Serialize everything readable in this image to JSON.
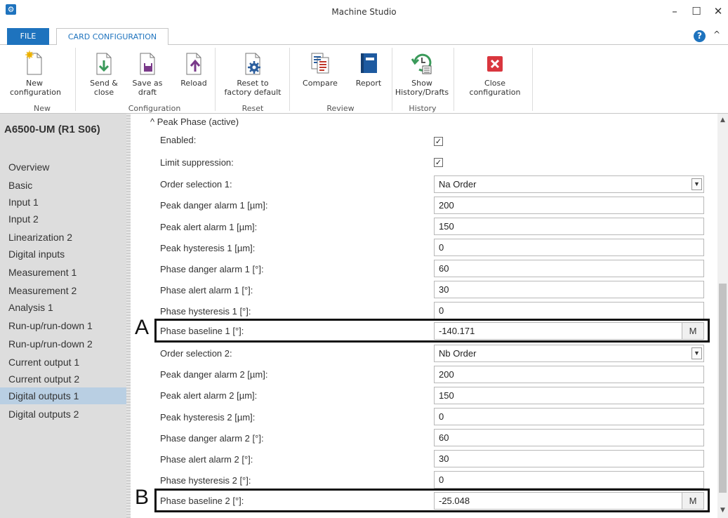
{
  "window": {
    "title": "Machine Studio",
    "minimize": "–",
    "maximize": "☐",
    "close": "✕"
  },
  "tabs": {
    "file": "FILE",
    "card_configuration": "CARD CONFIGURATION",
    "collapse": "^"
  },
  "ribbon": {
    "buttons": [
      {
        "label": "New\nconfiguration",
        "icon": "new-document-icon"
      },
      {
        "label": "Send &\nclose",
        "icon": "send-close-icon"
      },
      {
        "label": "Save as\ndraft",
        "icon": "save-draft-icon"
      },
      {
        "label": "Reload",
        "icon": "reload-icon"
      },
      {
        "label": "Reset to\nfactory default",
        "icon": "reset-gear-icon"
      },
      {
        "label": "Compare",
        "icon": "compare-icon"
      },
      {
        "label": "Report",
        "icon": "report-icon"
      },
      {
        "label": "Show\nHistory/Drafts",
        "icon": "history-icon"
      },
      {
        "label": "Close\nconfiguration",
        "icon": "close-config-icon"
      }
    ],
    "groups": [
      "New",
      "Configuration",
      "Reset",
      "Review",
      "History"
    ]
  },
  "sidebar": {
    "title": "A6500-UM (R1 S06)",
    "items": [
      "Overview",
      "Basic",
      "Input 1",
      "Input 2",
      "Linearization 2",
      "Digital inputs",
      "Measurement 1",
      "Measurement 2",
      "Analysis 1",
      "Run-up/run-down 1",
      "Run-up/run-down 2",
      "Current output 1",
      "Current output 2",
      "Digital outputs 1",
      "Digital outputs 2"
    ],
    "selected_index": 13
  },
  "content": {
    "section_header": "^ Peak Phase (active)",
    "rows": [
      {
        "label": "Enabled:",
        "type": "checkbox",
        "checked": true
      },
      {
        "label": "Limit suppression:",
        "type": "checkbox",
        "checked": true
      },
      {
        "label": "Order selection 1:",
        "type": "select",
        "value": "Na Order"
      },
      {
        "label": "Peak danger alarm 1 [µm]:",
        "type": "text",
        "value": "200"
      },
      {
        "label": "Peak alert alarm 1 [µm]:",
        "type": "text",
        "value": "150"
      },
      {
        "label": "Peak hysteresis 1 [µm]:",
        "type": "text",
        "value": "0"
      },
      {
        "label": "Phase danger alarm 1 [°]:",
        "type": "text",
        "value": "60"
      },
      {
        "label": "Phase alert alarm 1 [°]:",
        "type": "text",
        "value": "30"
      },
      {
        "label": "Phase hysteresis 1 [°]:",
        "type": "text",
        "value": "0"
      },
      {
        "label": "Phase baseline 1 [°]:",
        "type": "measure",
        "value": "-140.171",
        "button": "M"
      },
      {
        "label": "Order selection 2:",
        "type": "select",
        "value": "Nb Order"
      },
      {
        "label": "Peak danger alarm 2 [µm]:",
        "type": "text",
        "value": "200"
      },
      {
        "label": "Peak alert alarm 2 [µm]:",
        "type": "text",
        "value": "150"
      },
      {
        "label": "Peak hysteresis 2 [µm]:",
        "type": "text",
        "value": "0"
      },
      {
        "label": "Phase danger alarm 2 [°]:",
        "type": "text",
        "value": "60"
      },
      {
        "label": "Phase alert alarm 2 [°]:",
        "type": "text",
        "value": "30"
      },
      {
        "label": "Phase hysteresis 2 [°]:",
        "type": "text",
        "value": "0"
      },
      {
        "label": "Phase baseline 2 [°]:",
        "type": "measure",
        "value": "-25.048",
        "button": "M"
      }
    ],
    "callouts": [
      "A",
      "B"
    ]
  },
  "colors": {
    "accent": "#1e73be",
    "sidebar_bg": "#dddddd",
    "selected_bg": "#b9cfe3",
    "close_red": "#d9363e",
    "history_green": "#3a9a5a"
  }
}
